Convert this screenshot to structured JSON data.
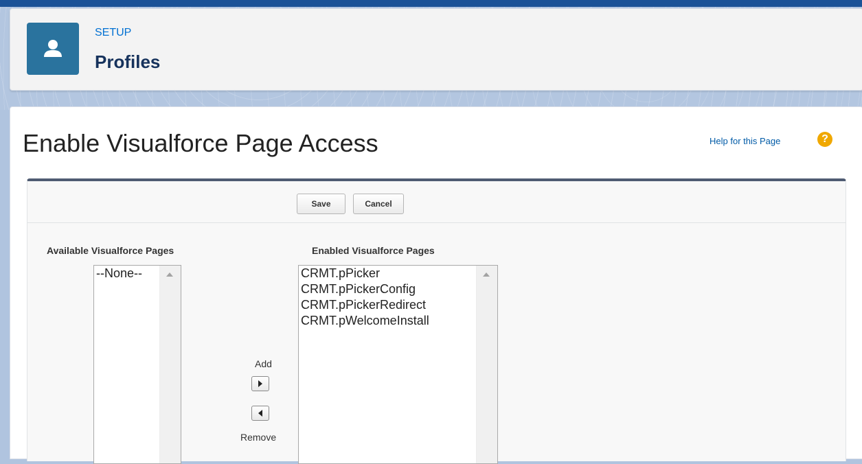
{
  "header": {
    "eyebrow": "SETUP",
    "title": "Profiles",
    "icon": "user-icon"
  },
  "page": {
    "title": "Enable Visualforce Page Access",
    "help_link": "Help for this Page",
    "help_icon": "help-icon"
  },
  "buttons": {
    "save": "Save",
    "cancel": "Cancel"
  },
  "available": {
    "label": "Available Visualforce Pages",
    "options": [
      "--None--"
    ]
  },
  "enabled": {
    "label": "Enabled Visualforce Pages",
    "options": [
      "CRMT.pPicker",
      "CRMT.pPickerConfig",
      "CRMT.pPickerRedirect",
      "CRMT.pWelcomeInstall"
    ]
  },
  "movers": {
    "add_label": "Add",
    "remove_label": "Remove"
  },
  "colors": {
    "brand_blue": "#1b5297",
    "icon_blue": "#2a739e",
    "link_blue": "#0070d2",
    "help_orange": "#f0a800"
  }
}
